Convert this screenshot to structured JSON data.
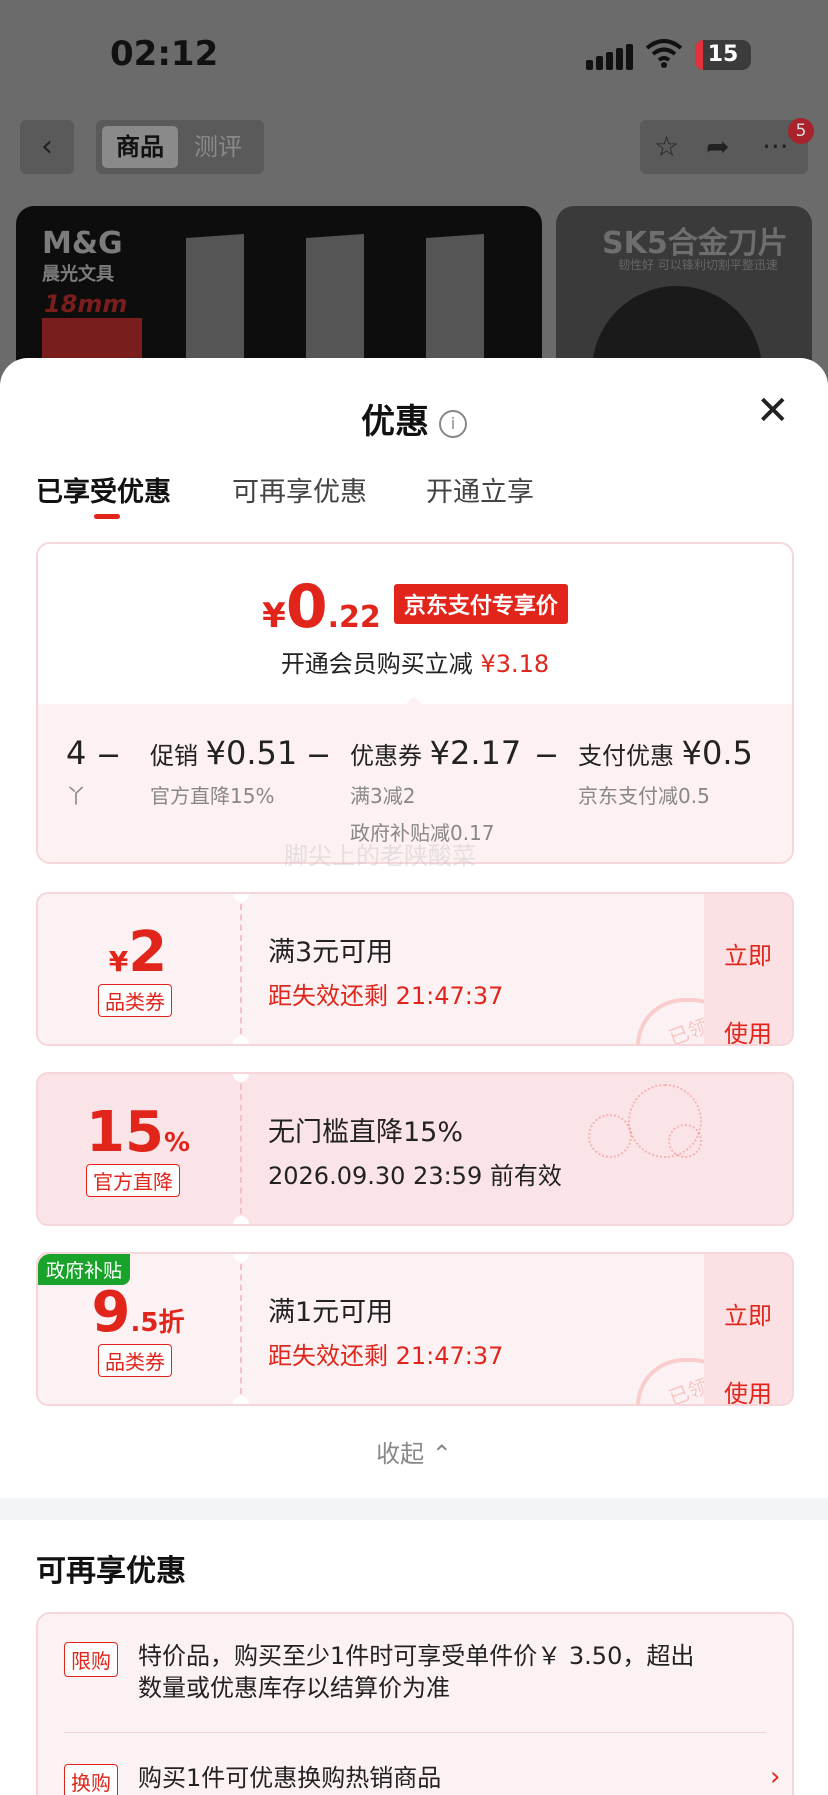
{
  "status_bar": {
    "time": "02:12",
    "battery": "15"
  },
  "background_page": {
    "nav_tabs": [
      "商品",
      "测评"
    ],
    "badge_count": "5",
    "product1": {
      "brand": "M&G",
      "brand_cn": "晨光文具",
      "size_label": "18mm"
    },
    "product2": {
      "title": "SK5合金刀片",
      "subtitle": "韧性好 可以锋利切割平整迅速"
    }
  },
  "sheet": {
    "title": "优惠",
    "tabs": [
      "已享受优惠",
      "可再享优惠",
      "开通立享"
    ],
    "active_tab": 0
  },
  "summary": {
    "price_symbol": "¥",
    "price_int": "0",
    "price_dec": ".22",
    "pay_tag": "京东支付专享价",
    "member_text": "开通会员购买立减",
    "member_amount": "¥3.18",
    "breakdown": [
      {
        "label": "4",
        "value": "",
        "sub": "丫"
      },
      {
        "label": "促销",
        "value": "¥0.51",
        "sub": "官方直降15%"
      },
      {
        "label": "优惠券",
        "value": "¥2.17",
        "sub": "满3减2",
        "sub2": "政府补贴减0.17"
      },
      {
        "label": "支付优惠",
        "value": "¥0.5",
        "sub": "京东支付减0.5"
      }
    ],
    "minus": "−",
    "watermark": "脚尖上的老陕酸菜"
  },
  "coupons": [
    {
      "amount_symbol": "¥",
      "amount": "2",
      "unit": "",
      "type": "品类券",
      "title": "满3元可用",
      "sub": "距失效还剩 21:47:37",
      "button": [
        "立即",
        "使用"
      ],
      "stamp": "已领"
    },
    {
      "amount_symbol": "",
      "amount": "15",
      "unit": "%",
      "type": "官方直降",
      "title": "无门槛直降15%",
      "sub": "2026.09.30 23:59 前有效"
    },
    {
      "amount_symbol": "",
      "amount": "9",
      "unit": ".5折",
      "type": "品类券",
      "gov_tag": "政府补贴",
      "title": "满1元可用",
      "sub": "距失效还剩 21:47:37",
      "button": [
        "立即",
        "使用"
      ],
      "stamp": "已领"
    }
  ],
  "collapse_label": "收起 ⌃",
  "section2": {
    "title": "可再享优惠",
    "promos": [
      {
        "tag": "限购",
        "text": "特价品，购买至少1件时可享受单件价￥ 3.50，超出数量或优惠库存以结算价为准"
      },
      {
        "tag": "换购",
        "text": "购买1件可优惠换购热销商品"
      }
    ]
  },
  "colors": {
    "accent": "#e1251b",
    "card_bg": "#fdf2f3",
    "gov_green": "#1aa32a"
  }
}
